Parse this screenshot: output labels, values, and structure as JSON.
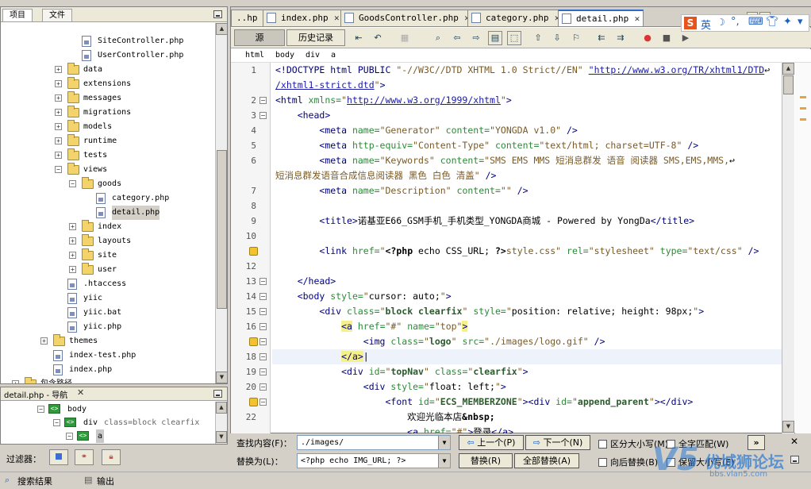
{
  "left_panel": {
    "tabs": [
      "项目",
      "文件"
    ],
    "tree": [
      {
        "label": "SiteController.php",
        "type": "file",
        "depth": 5
      },
      {
        "label": "UserController.php",
        "type": "file",
        "depth": 5
      },
      {
        "label": "data",
        "type": "folder",
        "depth": 4
      },
      {
        "label": "extensions",
        "type": "folder",
        "depth": 4
      },
      {
        "label": "messages",
        "type": "folder",
        "depth": 4
      },
      {
        "label": "migrations",
        "type": "folder",
        "depth": 4
      },
      {
        "label": "models",
        "type": "folder",
        "depth": 4
      },
      {
        "label": "runtime",
        "type": "folder",
        "depth": 4
      },
      {
        "label": "tests",
        "type": "folder",
        "depth": 4
      },
      {
        "label": "views",
        "type": "folder-open",
        "depth": 4
      },
      {
        "label": "goods",
        "type": "folder-open",
        "depth": 5
      },
      {
        "label": "category.php",
        "type": "file",
        "depth": 6
      },
      {
        "label": "detail.php",
        "type": "file",
        "depth": 6,
        "selected": true
      },
      {
        "label": "index",
        "type": "folder",
        "depth": 5
      },
      {
        "label": "layouts",
        "type": "folder",
        "depth": 5
      },
      {
        "label": "site",
        "type": "folder",
        "depth": 5
      },
      {
        "label": "user",
        "type": "folder",
        "depth": 5
      },
      {
        "label": ".htaccess",
        "type": "file",
        "depth": 4
      },
      {
        "label": "yiic",
        "type": "file",
        "depth": 4
      },
      {
        "label": "yiic.bat",
        "type": "file",
        "depth": 4
      },
      {
        "label": "yiic.php",
        "type": "file",
        "depth": 4
      },
      {
        "label": "themes",
        "type": "folder",
        "depth": 3
      },
      {
        "label": "index-test.php",
        "type": "file",
        "depth": 3
      },
      {
        "label": "index.php",
        "type": "file",
        "depth": 3
      },
      {
        "label": "包含路径",
        "type": "folder",
        "depth": 1
      }
    ]
  },
  "nav_panel": {
    "title": "detail.php - 导航",
    "rows": [
      {
        "text": "body",
        "attr": ""
      },
      {
        "text": "div",
        "attr": "class=block clearfix"
      },
      {
        "text": "a",
        "attr": ""
      }
    ],
    "filter_label": "过滤器："
  },
  "editor": {
    "tabs": [
      "..hp",
      "index.php",
      "GoodsController.php",
      "category.php",
      "detail.php"
    ],
    "active_tab": "detail.php",
    "view_source": "源",
    "view_history": "历史记录",
    "breadcrumb": [
      "html",
      "body",
      "div",
      "a"
    ],
    "line_numbers": [
      "1",
      "",
      "2",
      "3",
      "4",
      "5",
      "6",
      "",
      "7",
      "8",
      "9",
      "10",
      "11",
      "12",
      "13",
      "14",
      "15",
      "16",
      "17",
      "18",
      "19",
      "20",
      "21",
      "22"
    ]
  },
  "find_bar": {
    "find_label": "查找内容(F)：",
    "find_value": "./images/",
    "replace_label": "替换为(L)：",
    "replace_value": "<?php echo IMG_URL; ?>",
    "prev": "上一个(P)",
    "next": "下一个(N)",
    "replace": "替换(R)",
    "replace_all": "全部替换(A)",
    "match_case": "区分大小写(M)",
    "whole_word": "全字匹配(W)",
    "backwards": "向后替换(B)",
    "preserve_case": "保留大小写(E)",
    "more": "»"
  },
  "status_bar": {
    "search_results": "搜索结果",
    "output": "输出"
  },
  "ime": {
    "label": "英"
  },
  "watermark": {
    "text": "优城狮论坛",
    "url": "bbs.vlan5.com"
  },
  "colors": {
    "accent": "#316ac5",
    "tag": "#000080",
    "attr": "#2d8a38",
    "value": "#7a5a26",
    "match": "#f5f08a"
  }
}
